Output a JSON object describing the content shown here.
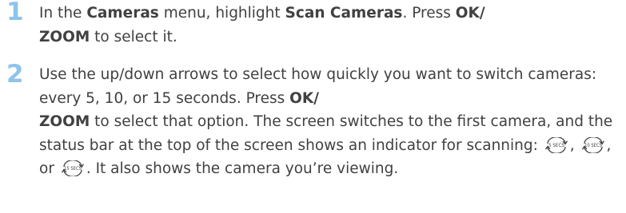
{
  "steps": [
    {
      "number": "1",
      "segments": [
        "In the ",
        "Cameras",
        " menu, highlight ",
        "Scan Cameras",
        ". Press ",
        "OK/",
        "ZOOM",
        " to select it."
      ]
    },
    {
      "number": "2",
      "segments": [
        "Use the up/down arrows to select how quickly you want to switch cameras: every 5, 10, or 15 seconds. Press ",
        "OK/",
        "ZOOM",
        " to select that option. The screen switches to the first camera, and the status bar at the top of the screen shows an indicator for scanning: ",
        ", ",
        ", or ",
        ". It also shows the camera you’re viewing."
      ],
      "icons": [
        {
          "name": "scan-5-secs-icon",
          "label": "5 SECS"
        },
        {
          "name": "scan-10-secs-icon",
          "label": "10 SECS"
        },
        {
          "name": "scan-15-secs-icon",
          "label": "15 SECS"
        }
      ]
    }
  ],
  "colors": {
    "step_number": "#8ec3ea",
    "body_text": "#414042"
  }
}
